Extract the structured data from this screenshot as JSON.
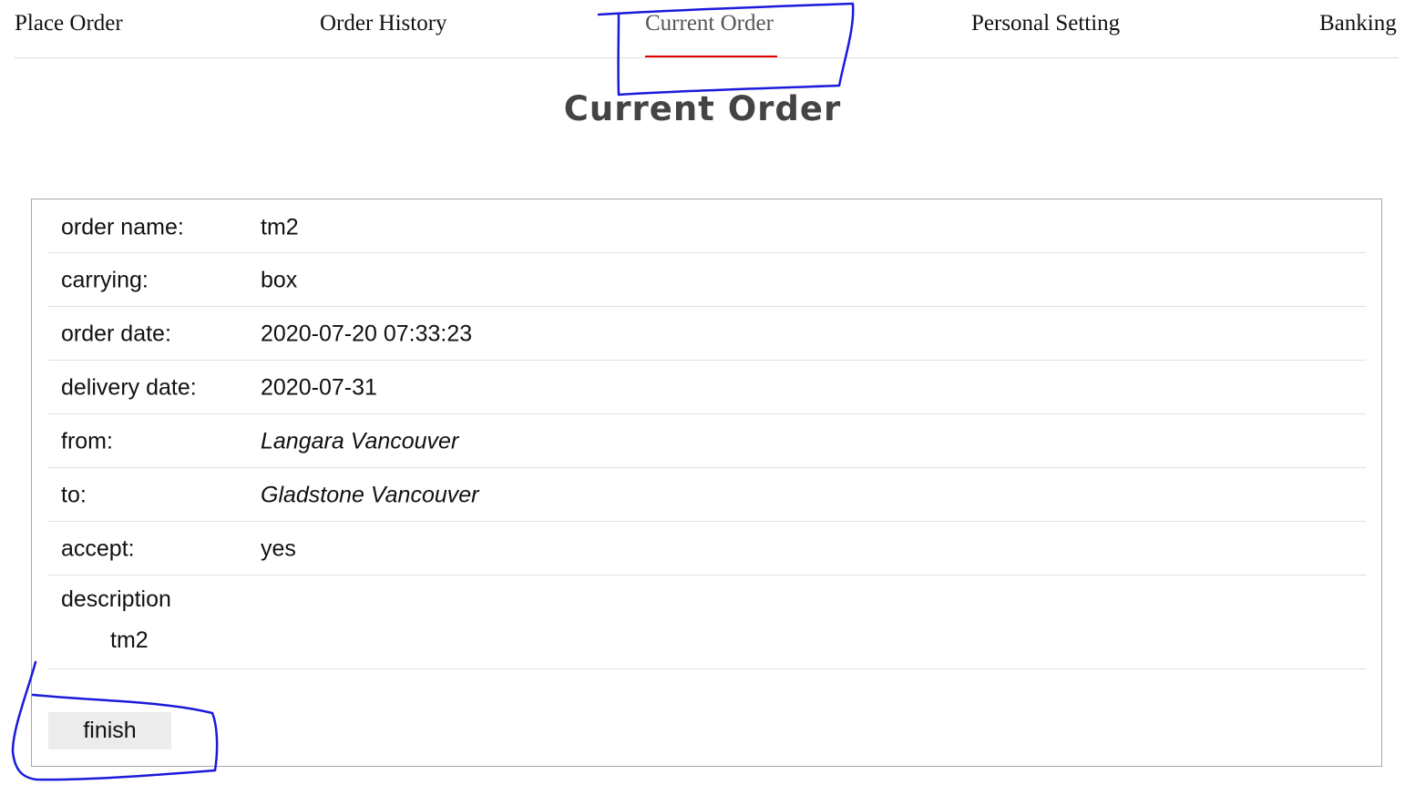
{
  "nav": {
    "items": [
      {
        "label": "Place Order"
      },
      {
        "label": "Order History"
      },
      {
        "label": "Current Order"
      },
      {
        "label": "Personal Setting"
      },
      {
        "label": "Banking"
      }
    ],
    "active_index": 2
  },
  "page": {
    "title": "Current Order"
  },
  "order": {
    "rows": [
      {
        "label": "order name:",
        "value": "tm2"
      },
      {
        "label": "carrying:",
        "value": "box"
      },
      {
        "label": "order date:",
        "value": "2020-07-20 07:33:23"
      },
      {
        "label": "delivery date:",
        "value": "2020-07-31"
      },
      {
        "label": "from:",
        "value": "Langara Vancouver"
      },
      {
        "label": "to:",
        "value": "Gladstone Vancouver"
      },
      {
        "label": "accept:",
        "value": "yes"
      }
    ],
    "description_label": "description",
    "description_value": "tm2"
  },
  "actions": {
    "finish_label": "finish"
  },
  "colors": {
    "active_underline": "#e00000",
    "annotation": "#1a1adb"
  }
}
